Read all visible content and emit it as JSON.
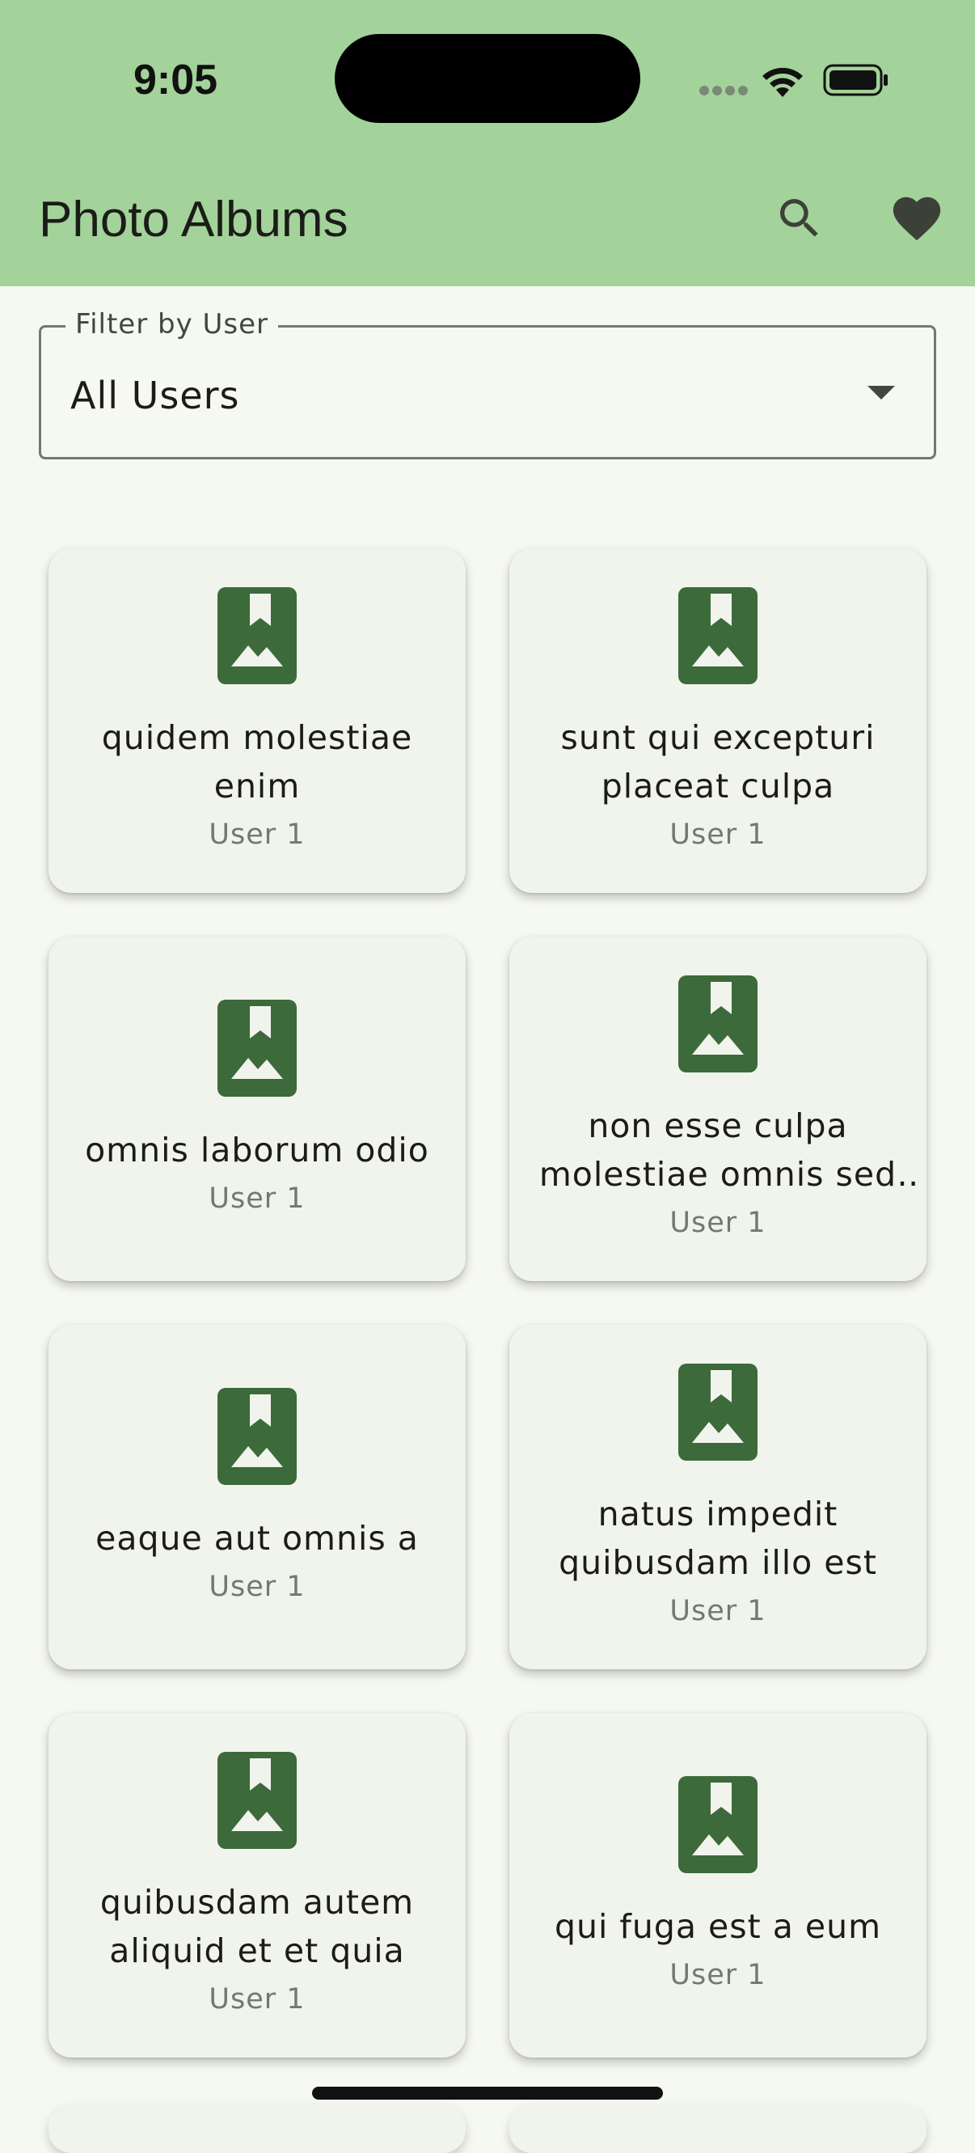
{
  "status_bar": {
    "time": "9:05",
    "icons": [
      "cellular-icon",
      "wifi-icon",
      "battery-icon"
    ]
  },
  "app_bar": {
    "title": "Photo Albums",
    "actions": [
      "search-icon",
      "heart-icon"
    ],
    "background": "#a3d39a"
  },
  "filter": {
    "label": "Filter by User",
    "value": "All Users"
  },
  "albums": [
    {
      "title": "quidem molestiae enim",
      "user": "User 1"
    },
    {
      "title": "sunt qui excepturi placeat culpa",
      "user": "User 1"
    },
    {
      "title": "omnis laborum odio",
      "user": "User 1"
    },
    {
      "title": "non esse culpa molestiae omnis sed o…",
      "user": "User 1"
    },
    {
      "title": "eaque aut omnis a",
      "user": "User 1"
    },
    {
      "title": "natus impedit quibusdam illo est",
      "user": "User 1"
    },
    {
      "title": "quibusdam autem aliquid et et quia",
      "user": "User 1"
    },
    {
      "title": "qui fuga est a eum",
      "user": "User 1"
    }
  ],
  "theme": {
    "accent": "#3c6a3a",
    "card_background": "#f1f4ec",
    "page_background": "#f6f9f1"
  }
}
